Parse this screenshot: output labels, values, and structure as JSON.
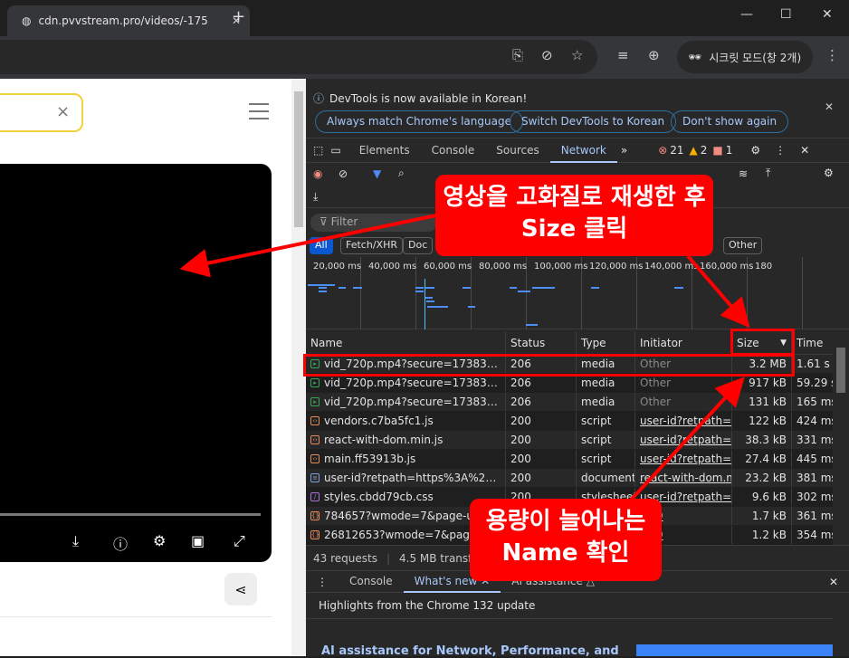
{
  "browser": {
    "tab_title": "cdn.pvvstream.pro/videos/-175",
    "new_tab": "+",
    "incognito_label": "시크릿 모드(창 2개)"
  },
  "page": {
    "search_clear": "×"
  },
  "devtools": {
    "infobar": {
      "message": "DevTools is now available in Korean!",
      "buttons": [
        "Always match Chrome's language",
        "Switch DevTools to Korean",
        "Don't show again"
      ]
    },
    "tabs": [
      "Elements",
      "Console",
      "Sources",
      "Network"
    ],
    "active_tab": "Network",
    "counts": {
      "errors": "21",
      "warnings": "2",
      "issues": "1"
    },
    "filter_placeholder": "Filter",
    "filter_chips": [
      "All",
      "Fetch/XHR",
      "Doc",
      "Other"
    ],
    "timeline_ticks": [
      "20,000 ms",
      "40,000 ms",
      "60,000 ms",
      "80,000 ms",
      "100,000 ms",
      "120,000 ms",
      "140,000 ms",
      "160,000 ms",
      "180"
    ],
    "columns": [
      "Name",
      "Status",
      "Type",
      "Initiator",
      "Size",
      "Time"
    ],
    "rows": [
      {
        "name": "vid_720p.mp4?secure=173837566...",
        "status": "206",
        "type": "media",
        "initiator": "Other",
        "size": "3.2 MB",
        "time": "1.61 s",
        "icon": "media"
      },
      {
        "name": "vid_720p.mp4?secure=173837566...",
        "status": "206",
        "type": "media",
        "initiator": "Other",
        "size": "917 kB",
        "time": "59.29 s",
        "icon": "media"
      },
      {
        "name": "vid_720p.mp4?secure=173837566...",
        "status": "206",
        "type": "media",
        "initiator": "Other",
        "size": "131 kB",
        "time": "165 ms",
        "icon": "media"
      },
      {
        "name": "vendors.c7ba5fc1.js",
        "status": "200",
        "type": "script",
        "initiator": "user-id?retpath=htt",
        "size": "122 kB",
        "time": "424 ms",
        "icon": "script"
      },
      {
        "name": "react-with-dom.min.js",
        "status": "200",
        "type": "script",
        "initiator": "user-id?retpath=htt",
        "size": "38.3 kB",
        "time": "331 ms",
        "icon": "script"
      },
      {
        "name": "main.ff53913b.js",
        "status": "200",
        "type": "script",
        "initiator": "user-id?retpath=htt",
        "size": "27.4 kB",
        "time": "445 ms",
        "icon": "script"
      },
      {
        "name": "user-id?retpath=https%3A%2F%2...",
        "status": "200",
        "type": "document",
        "initiator": "react-with-dom.min",
        "size": "23.2 kB",
        "time": "381 ms",
        "icon": "document"
      },
      {
        "name": "styles.cbdd79cb.css",
        "status": "200",
        "type": "stylesheet",
        "initiator": "user-id?retpath=htt",
        "size": "9.6 kB",
        "time": "302 ms",
        "icon": "stylesheet"
      },
      {
        "name": "784657?wmode=7&page-url=",
        "status": "",
        "type": "",
        "initiator": "s:99",
        "size": "1.7 kB",
        "time": "361 ms",
        "icon": "json"
      },
      {
        "name": "26812653?wmode=7&page-u",
        "status": "",
        "type": "",
        "initiator": "s:99",
        "size": "1.2 kB",
        "time": "354 ms",
        "icon": "json"
      }
    ],
    "status_bar": {
      "requests": "43 requests",
      "transferred": "4.5 MB transferre"
    },
    "drawer": {
      "tabs": [
        "Console",
        "What's new",
        "AI assistance"
      ],
      "active": "What's new",
      "highlights": "Highlights from the Chrome 132 update",
      "ai_heading": "AI assistance for Network, Performance, and"
    }
  },
  "annotations": {
    "callout1": [
      "영상을 고화질로 재생한 후",
      "Size 클릭"
    ],
    "callout2": [
      "용량이 늘어나는",
      "Name 확인"
    ],
    "color": "#ff0000"
  },
  "colors": {
    "accent": "#a8c7fa",
    "media": "#34a853",
    "script": "#e8895a",
    "document": "#7e9fe0",
    "stylesheet": "#b070e0"
  }
}
